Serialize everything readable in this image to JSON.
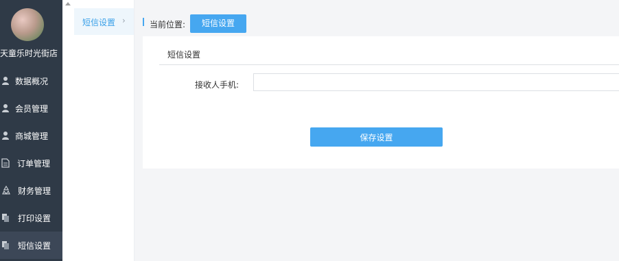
{
  "sidebar": {
    "shop_name": "天童乐时光街店",
    "items": [
      {
        "label": "数据概况",
        "icon": "user-icon"
      },
      {
        "label": "会员管理",
        "icon": "user-icon"
      },
      {
        "label": "商城管理",
        "icon": "user-icon"
      },
      {
        "label": "订单管理",
        "icon": "document-icon"
      },
      {
        "label": "财务管理",
        "icon": "recycle-icon"
      },
      {
        "label": "打印设置",
        "icon": "copy-icon"
      },
      {
        "label": "短信设置",
        "icon": "copy-icon",
        "active": true
      }
    ]
  },
  "submenu": {
    "item_label": "短信设置",
    "arrow": "›"
  },
  "breadcrumb": {
    "label": "当前位置:",
    "current": "短信设置"
  },
  "card": {
    "title": "短信设置",
    "phone_label": "接收人手机:",
    "phone_value": "",
    "save_label": "保存设置"
  },
  "colors": {
    "sidebar_bg": "#2f3a47",
    "accent": "#46a7f0"
  }
}
